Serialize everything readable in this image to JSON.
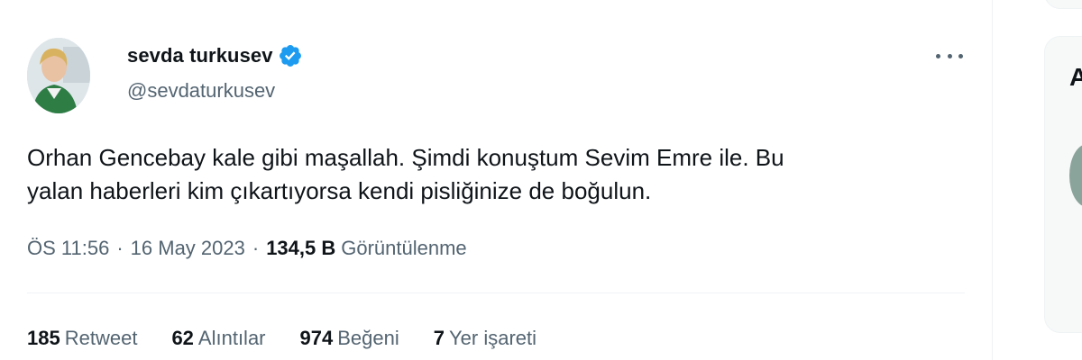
{
  "user": {
    "display_name": "sevda turkusev",
    "handle": "@sevdaturkusev",
    "verified_icon": "verified-badge-icon",
    "avatar_icon": "profile-photo"
  },
  "menu_icon": "more-dots-icon",
  "tweet": {
    "text_line1": "Orhan Gencebay kale gibi maşallah. Şimdi konuştum Sevim Emre ile. Bu",
    "text_line2": "yalan haberleri kim çıkartıyorsa kendi pisliğinize de boğulun."
  },
  "meta": {
    "time": "ÖS 11:56",
    "separator": "·",
    "date": "16 May 2023",
    "views_count": "134,5 B",
    "views_label": "Görüntülenme"
  },
  "stats": [
    {
      "count": "185",
      "label": "Retweet"
    },
    {
      "count": "62",
      "label": "Alıntılar"
    },
    {
      "count": "974",
      "label": "Beğeni"
    },
    {
      "count": "7",
      "label": "Yer işareti"
    }
  ],
  "sidebar": {
    "letter": "A"
  },
  "colors": {
    "text_primary": "#0f1419",
    "text_secondary": "#536471",
    "verified_blue": "#1d9bf0",
    "divider": "#eff3f4"
  }
}
